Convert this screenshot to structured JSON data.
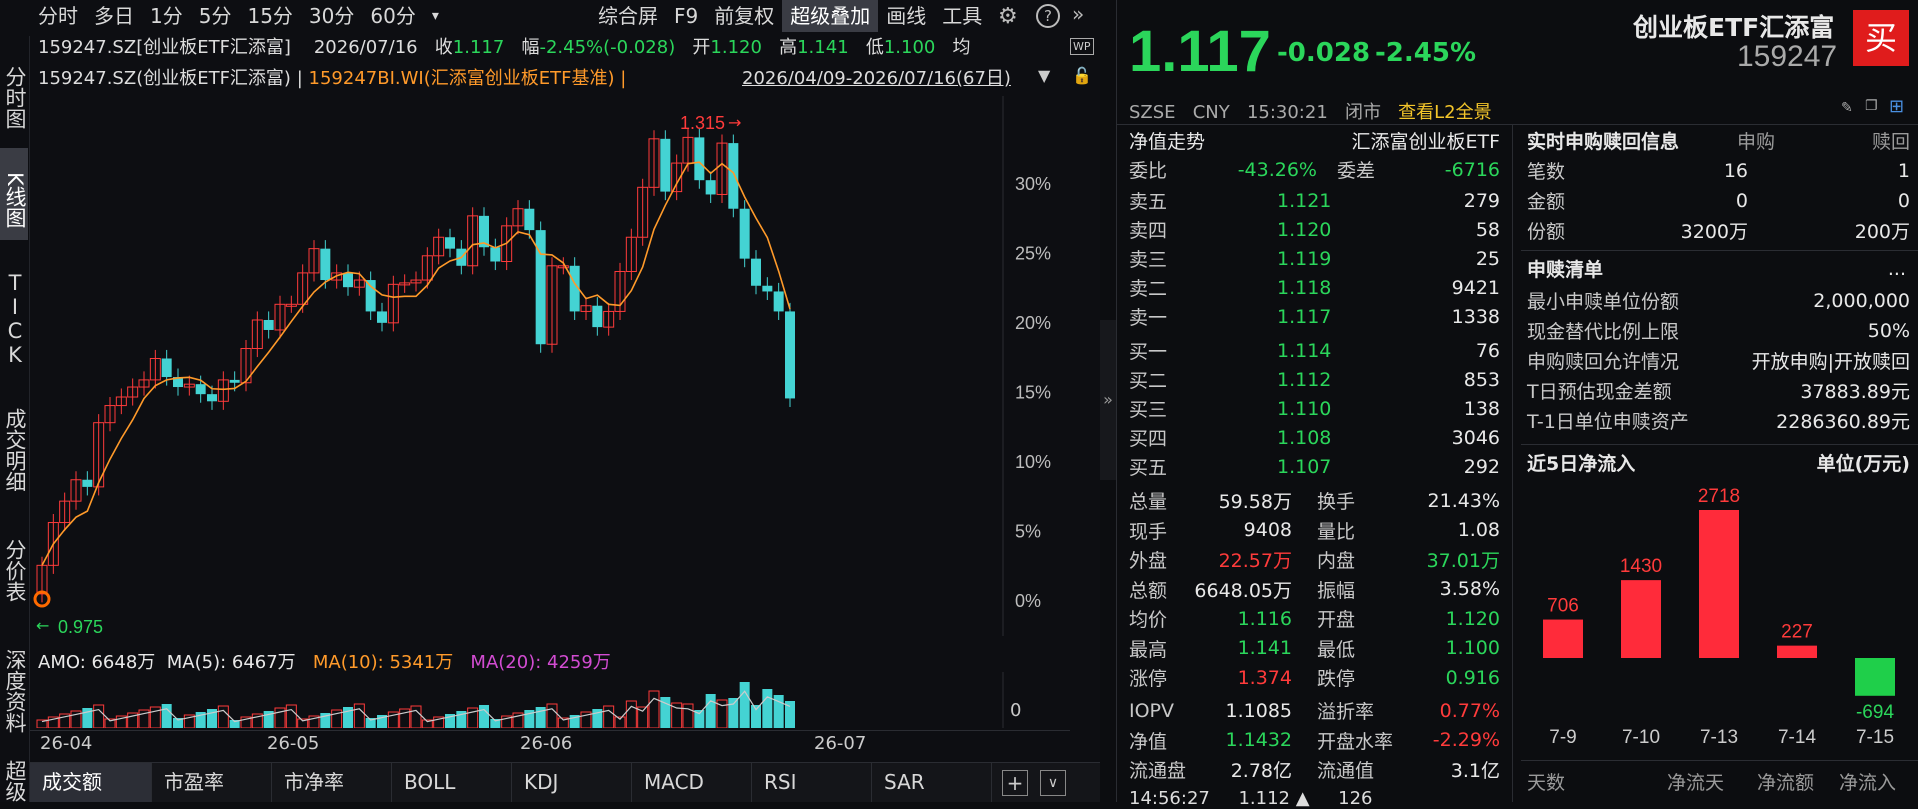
{
  "toolbar": {
    "periods": [
      "分时",
      "多日",
      "1分",
      "5分",
      "15分",
      "30分",
      "60分"
    ],
    "dropdown_glyph": "▾",
    "items": [
      "综合屏",
      "F9",
      "前复权",
      "超级叠加",
      "画线",
      "工具"
    ]
  },
  "left_vtabs": [
    "分时图",
    "K线图",
    "TICK",
    "成交明细",
    "分价表",
    "深度资料",
    "超级"
  ],
  "info1": {
    "code": "159247.SZ[创业板ETF汇添富]",
    "date": "2026/07/16",
    "close_label": "收",
    "close": "1.117",
    "chg_label": "幅",
    "chg": "-2.45%(-0.028)",
    "open_label": "开",
    "open": "1.120",
    "high_label": "高",
    "high": "1.141",
    "low_label": "低",
    "low": "1.100",
    "avg_label": "均"
  },
  "info2": {
    "code": "159247.SZ(创业板ETF汇添富)",
    "sep": "|",
    "bench": "159247BI.WI(汇添富创业板ETF基准)",
    "sep2": "|",
    "range": "2026/04/09-2026/07/16(67日)"
  },
  "chart": {
    "max_label": "1.315",
    "min_label": "0.975",
    "y_ticks": [
      "30%",
      "25%",
      "20%",
      "15%",
      "10%",
      "5%",
      "0%"
    ],
    "x_ticks": [
      "26-04",
      "26-05",
      "26-06",
      "26-07"
    ],
    "amo": {
      "amo": "AMO: 6648万",
      "ma5": "MA(5): 6467万",
      "ma10": "MA(10): 5341万",
      "ma20": "MA(20): 4259万",
      "tick0": "0"
    },
    "colors": {
      "up": "#ff3b3b",
      "down": "#44d3d3",
      "ma": "#ff9a2a"
    }
  },
  "chart_data": {
    "type": "candlestick",
    "x_labels": [
      "26-04",
      "26-05",
      "26-06",
      "26-07"
    ],
    "closes": [
      1.0,
      1.03,
      1.045,
      1.06,
      1.055,
      1.1,
      1.112,
      1.118,
      1.125,
      1.13,
      1.145,
      1.132,
      1.125,
      1.127,
      1.12,
      1.115,
      1.13,
      1.128,
      1.152,
      1.172,
      1.165,
      1.183,
      1.183,
      1.205,
      1.222,
      1.2,
      1.205,
      1.195,
      1.2,
      1.178,
      1.17,
      1.197,
      1.198,
      1.2,
      1.217,
      1.23,
      1.222,
      1.21,
      1.245,
      1.223,
      1.213,
      1.238,
      1.25,
      1.235,
      1.155,
      1.21,
      1.21,
      1.178,
      1.182,
      1.167,
      1.178,
      1.206,
      1.23,
      1.265,
      1.299,
      1.262,
      1.282,
      1.3,
      1.27,
      1.26,
      1.296,
      1.25,
      1.215,
      1.196,
      1.192,
      1.178,
      1.117
    ]
  },
  "bottom_tabs": [
    "成交额",
    "市盈率",
    "市净率",
    "BOLL",
    "KDJ",
    "MACD",
    "RSI",
    "SAR"
  ],
  "quote": {
    "price": "1.117",
    "chg": "-0.028",
    "pct": "-2.45%",
    "name": "创业板ETF汇添富",
    "code": "159247",
    "buy": "买",
    "meta": [
      "SZSE",
      "CNY",
      "15:30:21",
      "闭市"
    ],
    "l2": "查看L2全景"
  },
  "order": {
    "title": "净值走势",
    "fund": "汇添富创业板ETF",
    "wb_label": "委比",
    "wb": "-43.26%",
    "wc_label": "委差",
    "wc": "-6716",
    "asks": [
      [
        "卖五",
        "1.121",
        "279"
      ],
      [
        "卖四",
        "1.120",
        "58"
      ],
      [
        "卖三",
        "1.119",
        "25"
      ],
      [
        "卖二",
        "1.118",
        "9421"
      ],
      [
        "卖一",
        "1.117",
        "1338"
      ]
    ],
    "bids": [
      [
        "买一",
        "1.114",
        "76"
      ],
      [
        "买二",
        "1.112",
        "853"
      ],
      [
        "买三",
        "1.110",
        "138"
      ],
      [
        "买四",
        "1.108",
        "3046"
      ],
      [
        "买五",
        "1.107",
        "292"
      ]
    ]
  },
  "stats": [
    [
      "总量",
      "59.58万",
      "w",
      "换手",
      "21.43%",
      "w"
    ],
    [
      "现手",
      "9408",
      "w",
      "量比",
      "1.08",
      "w"
    ],
    [
      "外盘",
      "22.57万",
      "r",
      "内盘",
      "37.01万",
      "g"
    ],
    [
      "总额",
      "6648.05万",
      "w",
      "振幅",
      "3.58%",
      "w"
    ],
    [
      "均价",
      "1.116",
      "g",
      "开盘",
      "1.120",
      "g"
    ],
    [
      "最高",
      "1.141",
      "g",
      "最低",
      "1.100",
      "g"
    ],
    [
      "涨停",
      "1.374",
      "r",
      "跌停",
      "0.916",
      "g"
    ]
  ],
  "stats2": [
    [
      "IOPV",
      "1.1085",
      "w",
      "溢折率",
      "0.77%",
      "r"
    ],
    [
      "净值",
      "1.1432",
      "g",
      "开盘水率",
      "-2.29%",
      "r"
    ],
    [
      "流通盘",
      "2.78亿",
      "w",
      "流通值",
      "3.1亿",
      "w"
    ]
  ],
  "tickrow": "14:56:27     1.112 ▲     126",
  "sub": {
    "title": "实时申购赎回信息",
    "h1": "申购",
    "h2": "赎回",
    "rows": [
      [
        "笔数",
        "16",
        "1"
      ],
      [
        "金额",
        "0",
        "0"
      ],
      [
        "份额",
        "3200万",
        "200万"
      ]
    ]
  },
  "list": {
    "title": "申赎清单",
    "more": "...",
    "rows": [
      [
        "最小申赎单位份额",
        "2,000,000"
      ],
      [
        "现金替代比例上限",
        "50%"
      ],
      [
        "申购赎回允许情况",
        "开放申购|开放赎回"
      ],
      [
        "T日预估现金差额",
        "37883.89元"
      ],
      [
        "T-1日单位申赎资产",
        "2286360.89元"
      ]
    ]
  },
  "flow": {
    "title": "近5日净流入",
    "unit": "单位(万元)",
    "days": [
      "7-9",
      "7-10",
      "7-13",
      "7-14",
      "7-15"
    ],
    "values": [
      706,
      1430,
      2718,
      227,
      -694
    ],
    "footer": [
      "天数",
      "净流天",
      "净流额",
      "净流入"
    ]
  }
}
